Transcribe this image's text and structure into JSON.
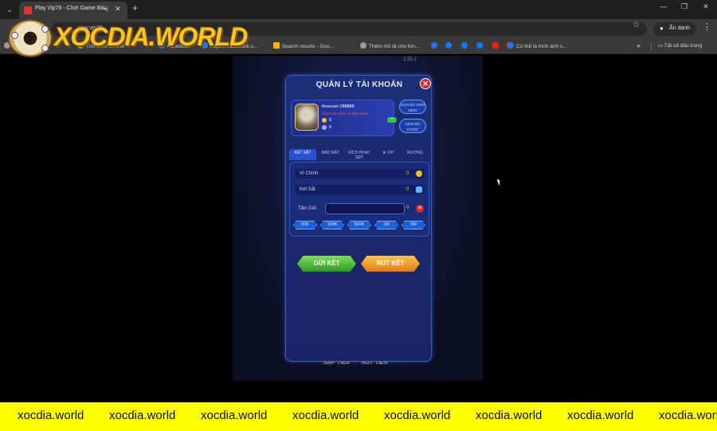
{
  "browser": {
    "tab_title": "Play Vip79 - Chơi Game Bài",
    "omnibox_text": "play.vip79",
    "incognito_label": "Ẩn danh",
    "bookmarks": [
      {
        "label": "ia",
        "icon": "globe-icon"
      },
      {
        "label": "Tìm kiếm tin trên",
        "icon": "globe-icon"
      },
      {
        "label": "Facebook",
        "icon": "facebook-icon"
      },
      {
        "label": "https://l.facebook.c...",
        "icon": "facebook-icon"
      },
      {
        "label": "Search results - Goo...",
        "icon": "google-drive-icon"
      },
      {
        "label": "Thêm mô tả cho hìn...",
        "icon": "globe-icon"
      },
      {
        "label": "",
        "icon": "facebook-icon"
      },
      {
        "label": "",
        "icon": "facebook-icon"
      },
      {
        "label": "",
        "icon": "facebook-icon"
      },
      {
        "label": "",
        "icon": "facebook-icon"
      },
      {
        "label": "",
        "icon": "youtube-icon"
      },
      {
        "label": "",
        "icon": "youtube-icon"
      },
      {
        "label": "Có thể là hình ảnh v...",
        "icon": "facebook-icon"
      }
    ],
    "all_bookmarks_label": "Tất cả dấu trang"
  },
  "watermark": {
    "logo_text": "XOCDIA.WORLD",
    "ticker_text": "xocdia.world",
    "ticker_repeats": 8
  },
  "game": {
    "version": "2.25.1",
    "bottom_buttons": [
      "NẠP TIỀN",
      "RÚT TIỀN"
    ]
  },
  "modal": {
    "title": "QUẢN LÝ TÀI KHOẢN",
    "profile": {
      "username": "thewuan 188888",
      "warning": "Chưa xác thực số điện thoại",
      "gold": "0",
      "silver": "0"
    },
    "side_buttons": [
      "LỊCH SỬ GIAO DỊCH",
      "LỊCH SỬ CƯỢC"
    ],
    "tabs": [
      "KÉT SẮT",
      "BẢO MẬT",
      "KÍCH HOẠT SĐT",
      "VIP",
      "RƯƠNG"
    ],
    "active_tab": 0,
    "rows": [
      {
        "label": "Ví Chính",
        "value": "0"
      },
      {
        "label": "Két Sắt",
        "value": "0"
      }
    ],
    "amount_label": "Tiền Gửi",
    "amount_value": "",
    "amount_coin": "0",
    "chips": [
      "50K",
      "100K",
      "500K",
      "1M",
      "5M"
    ],
    "deposit_button": "GỬI KÉT",
    "withdraw_button": "RÚT KÉT"
  },
  "colors": {
    "modal_bg": "#1b2f78",
    "ticker_bg": "#ffff00",
    "logo_gold": "#f5c428",
    "deposit_green": "#2f9a22",
    "withdraw_orange": "#e07b10"
  }
}
